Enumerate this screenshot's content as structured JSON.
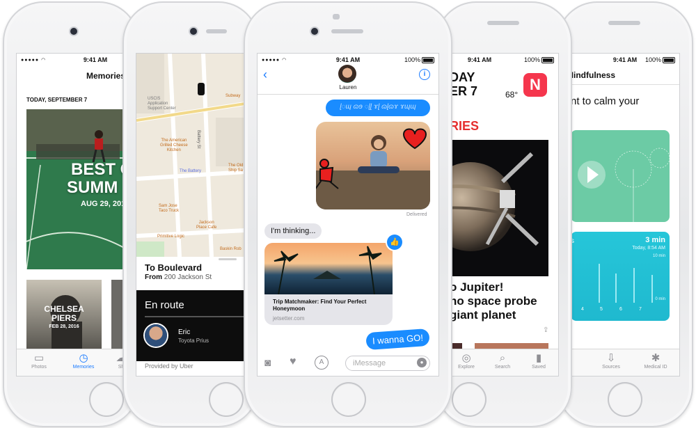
{
  "status": {
    "time": "9:41 AM",
    "battery": "100%"
  },
  "photos": {
    "title": "Memories",
    "section": "TODAY, SEPTEMBER 7",
    "memory_title_line1": "BEST O",
    "memory_title_line2": "SUMM",
    "memory_date": "AUG 29, 201",
    "memory2_title_line1": "CHELSEA",
    "memory2_title_line2": "PIERS",
    "memory2_date": "FEB 28, 2016",
    "tabs": [
      {
        "label": "Photos",
        "icon": "photos-icon"
      },
      {
        "label": "Memories",
        "icon": "memories-icon"
      },
      {
        "label": "Sh",
        "icon": "shared-icon"
      }
    ]
  },
  "maps": {
    "labels": {
      "uscis": "USCIS\nApplication\nSupport Center",
      "grilled": "The American\nGrilled Cheese\nKitchen",
      "subway": "Subway",
      "battery": "The Battery",
      "battery_st": "Battery St",
      "ship": "The Old\nShip Sa",
      "tacos": "Sam Jose\nTaco Truck",
      "jackson": "Jackson\nPlace Cafe",
      "primitive": "Primitive Logic",
      "baskin": "Baskin Rob"
    },
    "destination": "To Boulevard",
    "from_prefix": "From",
    "from_address": "200 Jackson St",
    "en_route": "En route",
    "driver_name": "Eric",
    "driver_car": "Toyota Prius",
    "provider": "Provided by Uber"
  },
  "messages": {
    "contact": "Lauren",
    "handwriting": "ɭ◌ɰ ɷɘ ◌ɭɭ ɤɭ ɷɭɷɤ ɤɰɰ",
    "delivered": "Delivered",
    "thinking": "I'm thinking...",
    "link_title": "Trip Matchmaker: Find Your Perfect Honeymoon",
    "link_domain": "jetsetter.com",
    "reply": "I wanna GO!",
    "input_placeholder": "iMessage"
  },
  "news": {
    "header_line1": "DAY",
    "header_line2": "ER 7",
    "temperature": "68°",
    "section": "RIES",
    "headline": "o Jupiter!\nno space probe\ngiant planet",
    "tabs": [
      {
        "label": "Explore",
        "icon": "explore-icon"
      },
      {
        "label": "Search",
        "icon": "search-icon"
      },
      {
        "label": "Saved",
        "icon": "bookmark-icon"
      }
    ]
  },
  "health": {
    "title": "Mindfulness",
    "prompt": "nt to calm your",
    "duration": "3 min",
    "date": "Today, 8:54 AM",
    "axis_top": "10 min",
    "axis_bottom": "0 min",
    "x_ticks": [
      "4",
      "5",
      "6",
      "7"
    ],
    "tabs": [
      {
        "label": "Sources",
        "icon": "sources-icon"
      },
      {
        "label": "Medical ID",
        "icon": "medical-id-icon"
      }
    ]
  }
}
